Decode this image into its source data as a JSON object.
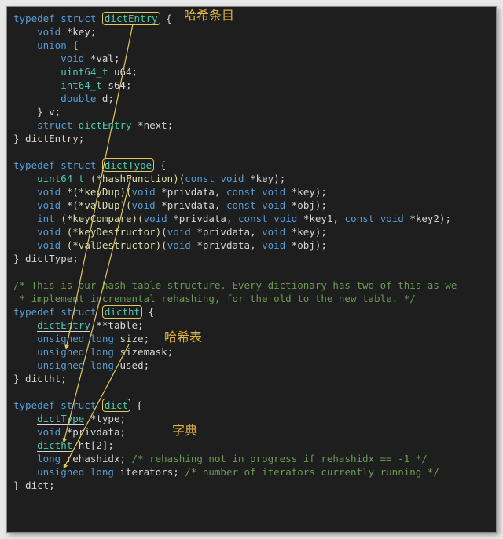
{
  "annotations": {
    "entry": "哈希条目",
    "table": "哈希表",
    "dict": "字典"
  },
  "comments": {
    "hash1": "/* This is our hash table structure. Every dictionary has two of this as we",
    "hash2": " * implement incremental rehashing, for the old to the new table. */",
    "rehash": "/* rehashing not in progress if rehashidx == -1 */",
    "iter": "/* number of iterators currently running */"
  },
  "t": {
    "typedef": "typedef",
    "struct": "struct",
    "void": "void",
    "union": "union",
    "const": "const",
    "int": "int",
    "double": "double",
    "long": "long",
    "unsigned": "unsigned",
    "uint64_t": "uint64_t",
    "int64_t": "int64_t",
    "dictEntry": "dictEntry",
    "dictType": "dictType",
    "dictht": "dictht",
    "dict": "dict",
    "key": "*key;",
    "val": "*val;",
    "u64": " u64;",
    "s64": " s64;",
    "d": " d;",
    "v": "} v;",
    "next": "*next;",
    "endEntry": "} dictEntry;",
    "endType": "} dictType;",
    "endHt": "} dictht;",
    "endDict": "} dict;",
    "ob": " {",
    "cb": "}",
    "hashFn": " (*hashFunction)(",
    "keyDup": " *(*keyDup)(",
    "valDup": " *(*valDup)(",
    "keyCmp": " (*keyCompare)(",
    "keyDes": " (*keyDestructor)(",
    "valDes": " (*valDestructor)(",
    "priv": " *privdata",
    "keyp": " *key",
    "objp": " *obj",
    "k1": " *key1",
    "k2": " *key2",
    "cparen": ");",
    "table": " **table;",
    "size": " size;",
    "mask": " sizemask;",
    "used": " used;",
    "type": " *type;",
    "privS": " *privdata;",
    "ht": " ht[2];",
    "rehash": " rehashidx; ",
    "iters": " iterators; "
  },
  "chart_data": {
    "type": "table",
    "title": "Redis dict C struct definitions",
    "structs": [
      {
        "name": "dictEntry",
        "annotation": "哈希条目",
        "fields": [
          "void *key;",
          "union { void *val; uint64_t u64; int64_t s64; double d; } v;",
          "struct dictEntry *next;"
        ]
      },
      {
        "name": "dictType",
        "fields": [
          "uint64_t (*hashFunction)(const void *key);",
          "void *(*keyDup)(void *privdata, const void *key);",
          "void *(*valDup)(void *privdata, const void *obj);",
          "int (*keyCompare)(void *privdata, const void *key1, const void *key2);",
          "void (*keyDestructor)(void *privdata, void *key);",
          "void (*valDestructor)(void *privdata, void *obj);"
        ]
      },
      {
        "name": "dictht",
        "annotation": "哈希表",
        "comment": "/* This is our hash table structure. Every dictionary has two of this as we implement incremental rehashing, for the old to the new table. */",
        "fields": [
          "dictEntry **table;",
          "unsigned long size;",
          "unsigned long sizemask;",
          "unsigned long used;"
        ]
      },
      {
        "name": "dict",
        "annotation": "字典",
        "fields": [
          "dictType *type;",
          "void *privdata;",
          "dictht ht[2];",
          "long rehashidx; /* rehashing not in progress if rehashidx == -1 */",
          "unsigned long iterators; /* number of iterators currently running */"
        ]
      }
    ],
    "arrows": [
      {
        "from": "dictEntry",
        "to": "dictht.table (dictEntry **table)"
      },
      {
        "from": "dictType",
        "to": "dict.type (dictType *type)"
      },
      {
        "from": "dictht",
        "to": "dict.ht (dictht ht[2])"
      }
    ]
  }
}
